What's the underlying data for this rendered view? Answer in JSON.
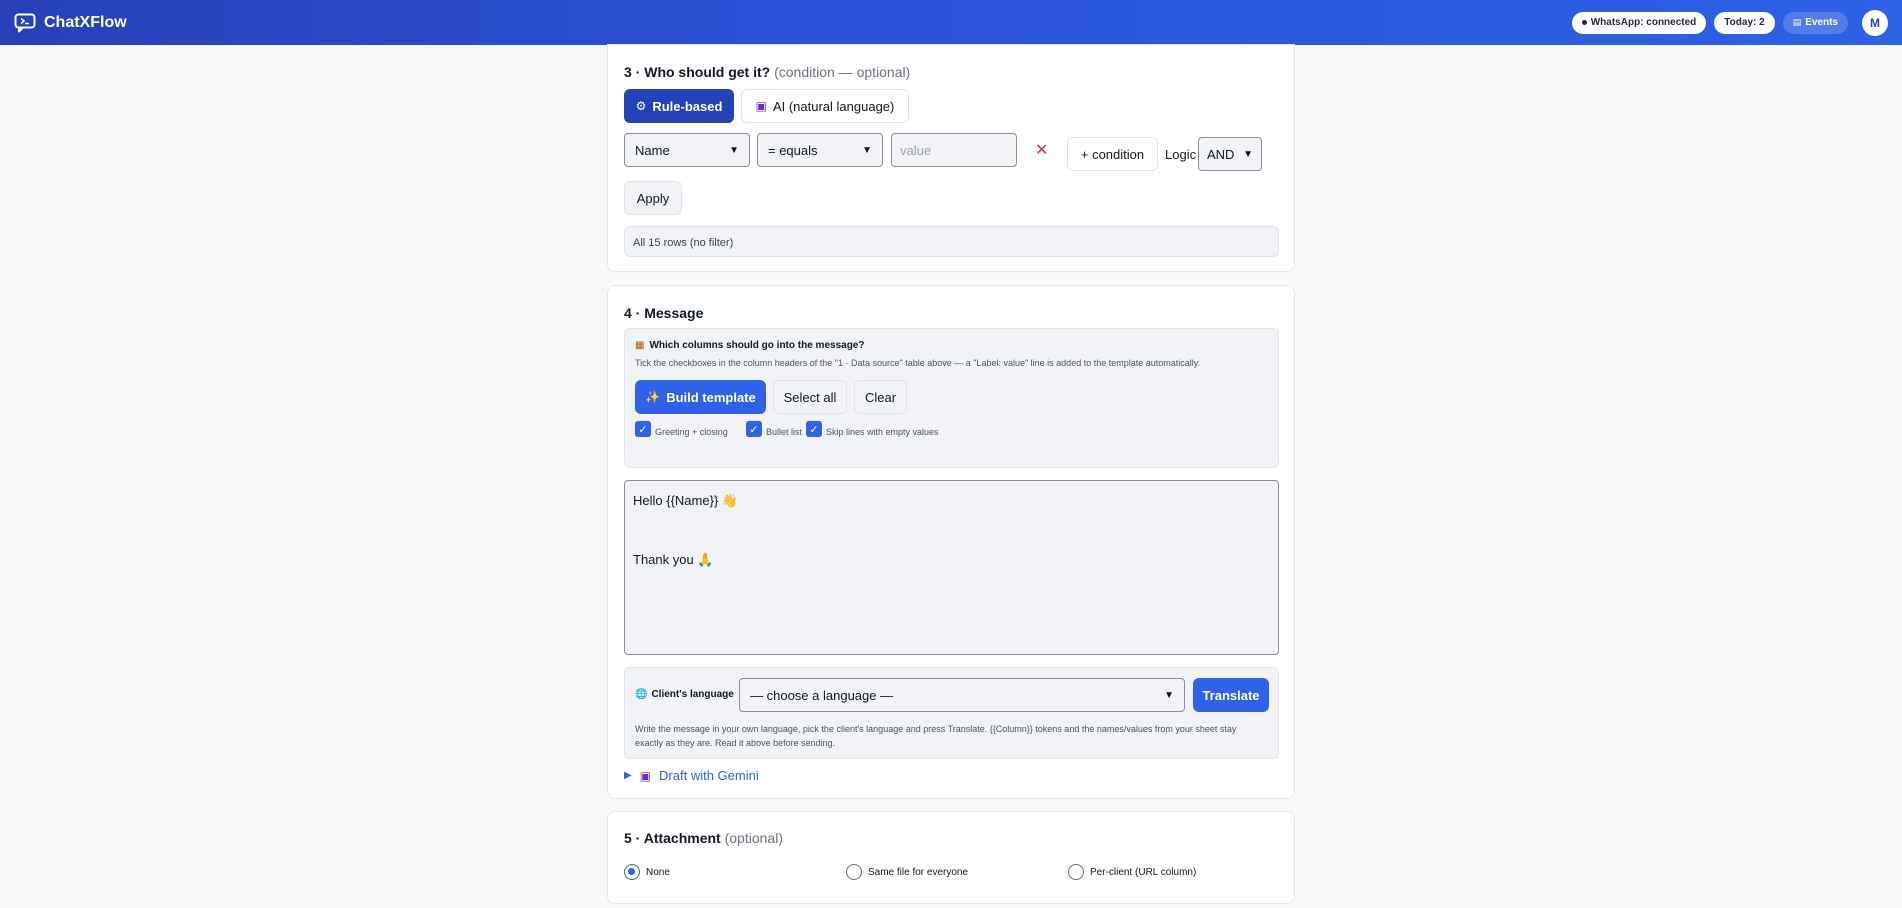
{
  "header": {
    "brand": "ChatXFlow",
    "whatsapp_status": "WhatsApp: connected",
    "today": "Today: 2",
    "events": "Events",
    "avatar_initial": "M"
  },
  "section3": {
    "title": "3 · Who should get it?",
    "subtitle": "(condition — optional)",
    "tab_rule": "Rule-based",
    "tab_ai": "AI (natural language)",
    "field_select": "Name",
    "op_select": "= equals",
    "value_placeholder": "value",
    "add_condition": "+ condition",
    "logic_label": "Logic",
    "logic_value": "AND",
    "apply": "Apply",
    "status": "All 15 rows (no filter)"
  },
  "section4": {
    "title": "4 · Message",
    "cols_heading": "Which columns should go into the message?",
    "cols_help": "Tick the checkboxes in the column headers of the \"1 · Data source\" table above — a \"Label: value\" line is added to the template automatically.",
    "build_template": "Build template",
    "select_all": "Select all",
    "clear": "Clear",
    "opt_greeting": "Greeting + closing",
    "opt_bullet": "Bullet list",
    "opt_skip": "Skip lines with empty values",
    "message_line1": "Hello {{Name}} 👋",
    "message_line2": "Thank you 🙏",
    "lang_label": "Client's language",
    "lang_select": "— choose a language —",
    "translate": "Translate",
    "lang_help": "Write the message in your own language, pick the client's language and press Translate. {{Column}} tokens and the names/values from your sheet stay exactly as they are. Read it above before sending.",
    "draft_gemini": "Draft with Gemini"
  },
  "section5": {
    "title": "5 · Attachment",
    "subtitle": "(optional)",
    "opt_none": "None",
    "opt_same": "Same file for everyone",
    "opt_per_client": "Per-client (URL column)"
  }
}
